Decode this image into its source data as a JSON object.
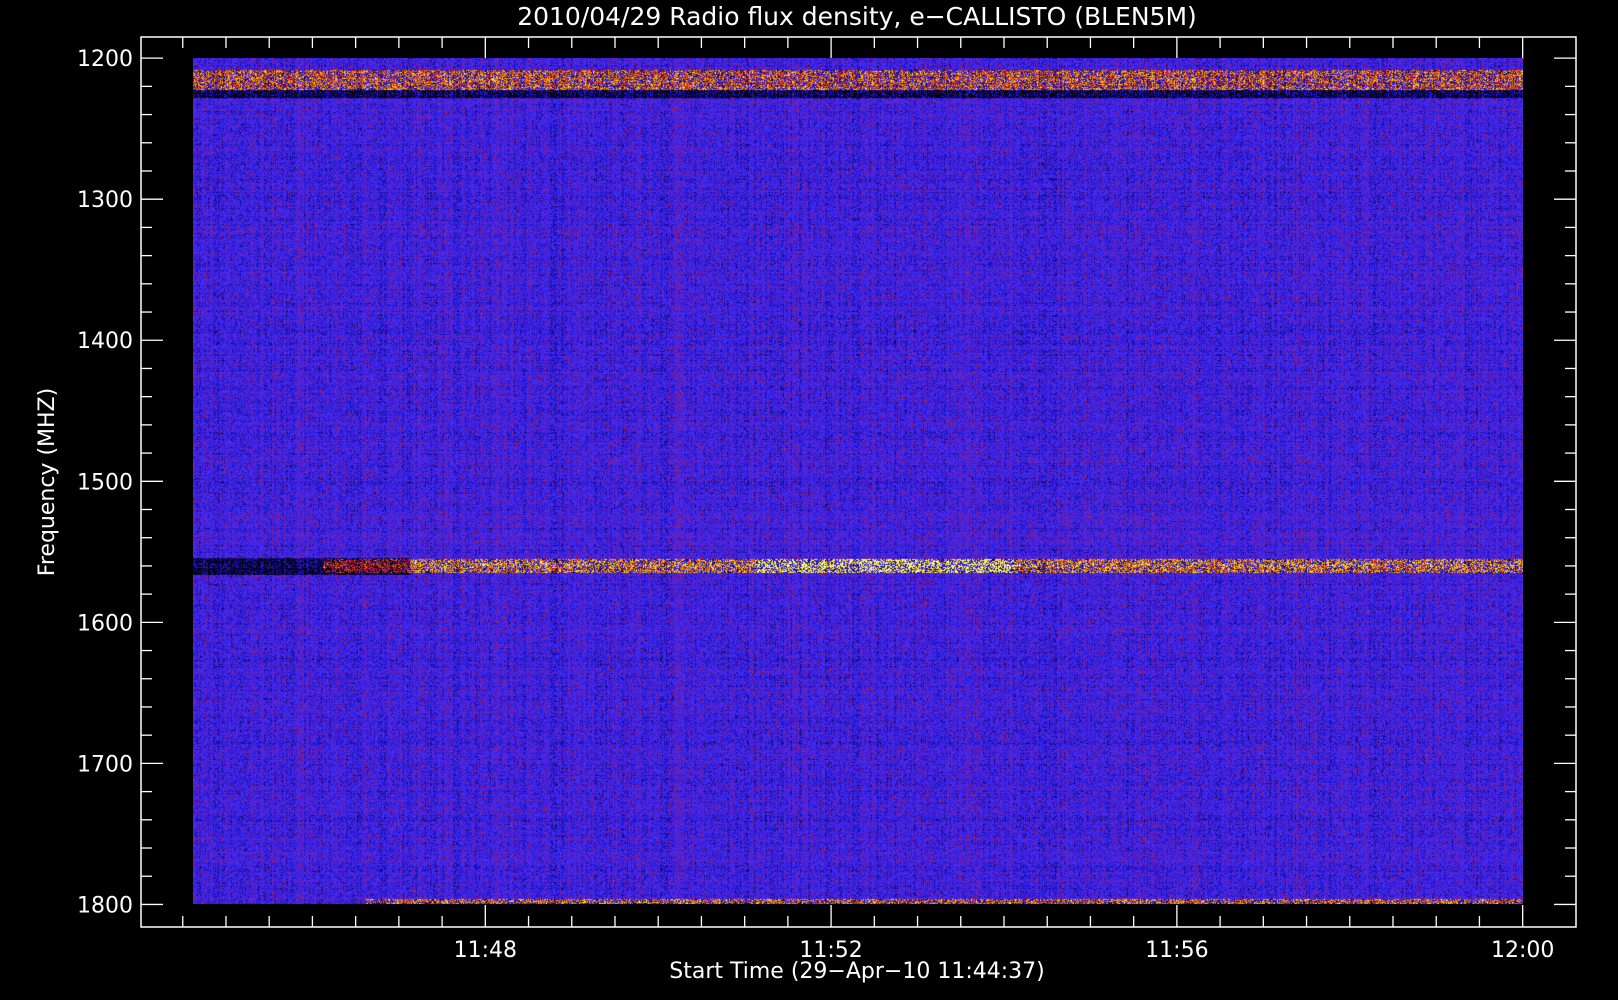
{
  "chart_data": {
    "type": "heatmap",
    "title": "2010/04/29  Radio flux density, e−CALLISTO (BLEN5M)",
    "xlabel": "Start Time (29−Apr−10 11:44:37)",
    "ylabel": "Frequency (MHZ)",
    "x_axis": {
      "ticks": [
        "11:48",
        "11:52",
        "11:56",
        "12:00"
      ],
      "tick_values_min": [
        3.383,
        7.383,
        11.383,
        15.383
      ],
      "range_min": [
        -0.6,
        16.0
      ],
      "data_range_min": [
        0.0,
        15.383
      ]
    },
    "y_axis": {
      "ticks": [
        "1200",
        "1300",
        "1400",
        "1500",
        "1600",
        "1700",
        "1800"
      ],
      "range": [
        1185,
        1816
      ],
      "data_range": [
        1200,
        1800
      ],
      "inverted": true
    },
    "colormap": [
      "#000000",
      "#1a10c8",
      "#4030ff",
      "#7a1a9c",
      "#c81414",
      "#ff6a00",
      "#ffd200",
      "#ffff80"
    ],
    "background_level": "blue/purple noise",
    "bright_bands": [
      {
        "freq_start": 1208,
        "freq_end": 1222,
        "intensity": "high, intermittent",
        "time_range": [
          0.0,
          15.383
        ]
      },
      {
        "freq_start": 1555,
        "freq_end": 1565,
        "intensity": "high, strongest 11:51–11:54",
        "time_range": [
          1.5,
          15.383
        ]
      },
      {
        "freq_start": 1796,
        "freq_end": 1800,
        "intensity": "moderate",
        "time_range": [
          2.0,
          15.383
        ]
      }
    ],
    "dark_bands": [
      {
        "freq_start": 1222,
        "freq_end": 1228
      },
      {
        "freq_start": 1554,
        "freq_end": 1566,
        "time_range": [
          0.0,
          2.5
        ]
      }
    ]
  }
}
